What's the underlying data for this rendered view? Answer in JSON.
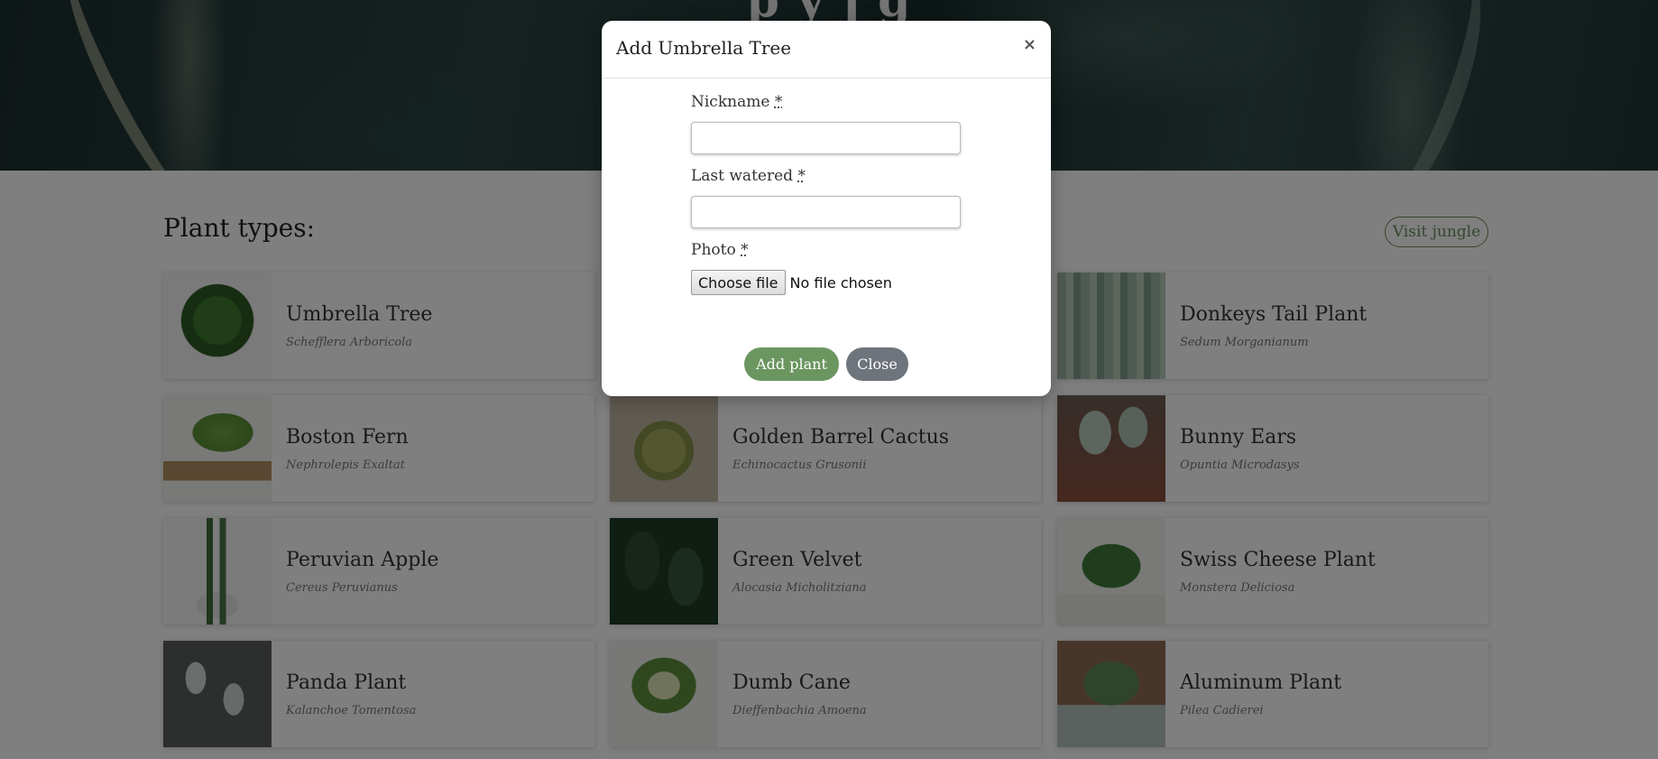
{
  "hero": {
    "title": "p  y  j  g"
  },
  "section": {
    "title": "Plant types:",
    "visit_button": "Visit jungle"
  },
  "plants": [
    {
      "name": "Umbrella Tree",
      "latin": "Schefflera Arboricola"
    },
    {
      "name": "",
      "latin": ""
    },
    {
      "name": "Donkeys Tail Plant",
      "latin": "Sedum Morganianum"
    },
    {
      "name": "Boston Fern",
      "latin": "Nephrolepis Exaltat"
    },
    {
      "name": "Golden Barrel Cactus",
      "latin": "Echinocactus Grusonii"
    },
    {
      "name": "Bunny Ears",
      "latin": "Opuntia Microdasys"
    },
    {
      "name": "Peruvian Apple",
      "latin": "Cereus Peruvianus"
    },
    {
      "name": "Green Velvet",
      "latin": "Alocasia Micholitziana"
    },
    {
      "name": "Swiss Cheese Plant",
      "latin": "Monstera Deliciosa"
    },
    {
      "name": "Panda Plant",
      "latin": "Kalanchoe Tomentosa"
    },
    {
      "name": "Dumb Cane",
      "latin": "Dieffenbachia Amoena"
    },
    {
      "name": "Aluminum Plant",
      "latin": "Pilea Cadierei"
    }
  ],
  "modal": {
    "title": "Add Umbrella Tree",
    "close_icon": "×",
    "fields": {
      "nickname_label": "Nickname",
      "last_watered_label": "Last watered",
      "photo_label": "Photo",
      "required_mark": "*",
      "nickname_value": "",
      "last_watered_value": ""
    },
    "file": {
      "button": "Choose file",
      "status": "No file chosen"
    },
    "buttons": {
      "add": "Add plant",
      "close": "Close"
    }
  },
  "colors": {
    "accent": "#6b9660",
    "secondary_button": "#6e747b",
    "overlay": "rgba(0,0,0,0.5)"
  }
}
